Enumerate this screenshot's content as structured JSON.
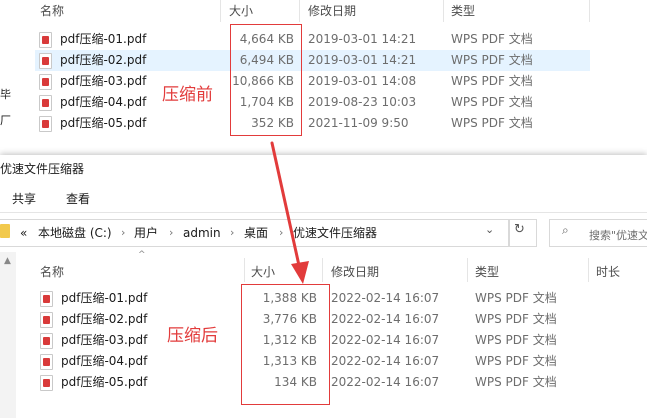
{
  "top_window": {
    "columns": {
      "name": "名称",
      "size": "大小",
      "date": "修改日期",
      "type": "类型"
    },
    "left_edge_chars": [
      "毕",
      "厂"
    ],
    "files": [
      {
        "name": "pdf压缩-01.pdf",
        "size": "4,664 KB",
        "date": "2019-03-01 14:21",
        "type": "WPS PDF 文档"
      },
      {
        "name": "pdf压缩-02.pdf",
        "size": "6,494 KB",
        "date": "2019-03-01 14:21",
        "type": "WPS PDF 文档"
      },
      {
        "name": "pdf压缩-03.pdf",
        "size": "10,866 KB",
        "date": "2019-03-01 14:08",
        "type": "WPS PDF 文档"
      },
      {
        "name": "pdf压缩-04.pdf",
        "size": "1,704 KB",
        "date": "2019-08-23 10:03",
        "type": "WPS PDF 文档"
      },
      {
        "name": "pdf压缩-05.pdf",
        "size": "352 KB",
        "date": "2021-11-09 9:50",
        "type": "WPS PDF 文档"
      }
    ],
    "annotation": "压缩前"
  },
  "bottom_window": {
    "title": "优速文件压缩器",
    "menu": [
      "共享",
      "查看"
    ],
    "breadcrumb": [
      "本地磁盘 (C:)",
      "用户",
      "admin",
      "桌面",
      "优速文件压缩器"
    ],
    "breadcrumb_prefix": "«",
    "search_placeholder": "搜索\"优速文",
    "columns": {
      "name": "名称",
      "size": "大小",
      "date": "修改日期",
      "type": "类型",
      "duration": "时长"
    },
    "files": [
      {
        "name": "pdf压缩-01.pdf",
        "size": "1,388 KB",
        "date": "2022-02-14 16:07",
        "type": "WPS PDF 文档"
      },
      {
        "name": "pdf压缩-02.pdf",
        "size": "3,776 KB",
        "date": "2022-02-14 16:07",
        "type": "WPS PDF 文档"
      },
      {
        "name": "pdf压缩-03.pdf",
        "size": "1,312 KB",
        "date": "2022-02-14 16:07",
        "type": "WPS PDF 文档"
      },
      {
        "name": "pdf压缩-04.pdf",
        "size": "1,313 KB",
        "date": "2022-02-14 16:07",
        "type": "WPS PDF 文档"
      },
      {
        "name": "pdf压缩-05.pdf",
        "size": "134 KB",
        "date": "2022-02-14 16:07",
        "type": "WPS PDF 文档"
      }
    ],
    "annotation": "压缩后"
  },
  "colors": {
    "accent_red": "#e23b3b",
    "selection": "#e5f3ff",
    "separator": "#e5e5e5"
  }
}
